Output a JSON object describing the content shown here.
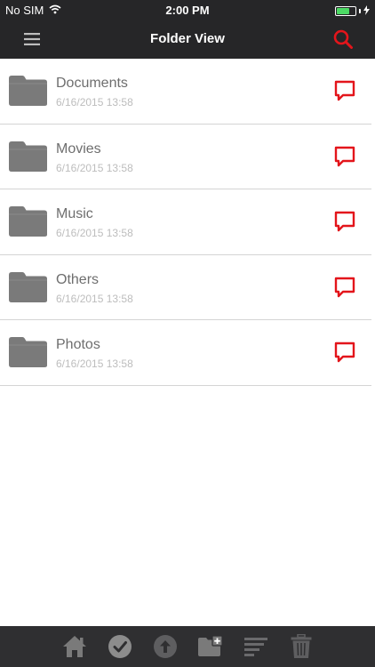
{
  "status_bar": {
    "carrier": "No SIM",
    "time": "2:00 PM",
    "battery_level": 0.7
  },
  "nav": {
    "title": "Folder View",
    "left_icon": "hamburger-menu-icon",
    "right_icon": "search-icon"
  },
  "folders": [
    {
      "name": "Documents",
      "date": "6/16/2015 13:58"
    },
    {
      "name": "Movies",
      "date": "6/16/2015 13:58"
    },
    {
      "name": "Music",
      "date": "6/16/2015 13:58"
    },
    {
      "name": "Others",
      "date": "6/16/2015 13:58"
    },
    {
      "name": "Photos",
      "date": "6/16/2015 13:58"
    }
  ],
  "toolbar": {
    "items": [
      "home-icon",
      "checkmark-icon",
      "upload-icon",
      "new-folder-icon",
      "sort-icon",
      "trash-icon"
    ]
  },
  "colors": {
    "bar_background": "#262628",
    "toolbar_background": "#2f2f31",
    "accent_red": "#e3151b",
    "folder_gray": "#7a7a7a",
    "text_gray": "#6e6e6e",
    "date_gray": "#bdbdbd"
  }
}
